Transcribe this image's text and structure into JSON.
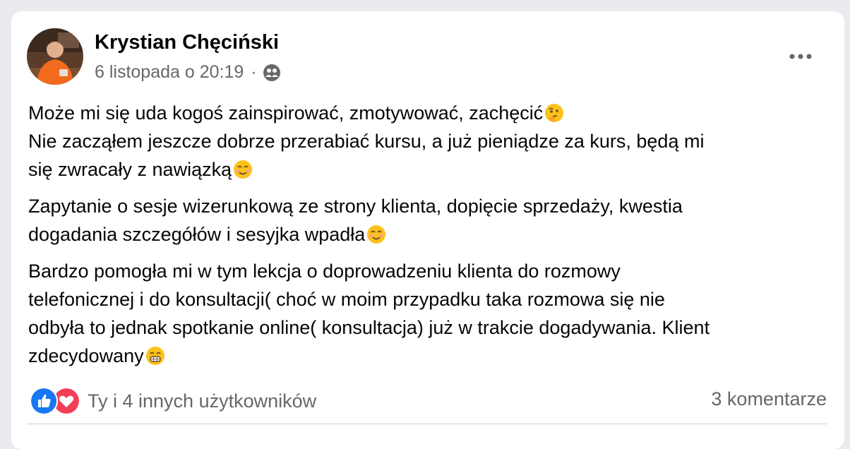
{
  "post": {
    "author": "Krystian Chęciński",
    "timestamp": "6 listopada o 20:19",
    "meta_separator": "·",
    "audience_icon": "people-icon",
    "menu_icon": "more-horizontal-icon",
    "paragraphs": [
      {
        "lines": [
          {
            "text": "Może mi się uda kogoś zainspirować, zmotywować, zachęcić",
            "emoji": "thinking-face-emoji"
          },
          {
            "text": "Nie zacząłem jeszcze dobrze przerabiać kursu, a już pieniądze za kurs, będą mi"
          },
          {
            "text": "się zwracały z nawiązką",
            "emoji": "smiling-face-emoji"
          }
        ]
      },
      {
        "lines": [
          {
            "text": "Zapytanie o sesje wizerunkową ze strony klienta, dopięcie sprzedaży, kwestia"
          },
          {
            "text": "dogadania szczegółów i sesyjka wpadła",
            "emoji": "smiling-face-emoji"
          }
        ]
      },
      {
        "lines": [
          {
            "text": "Bardzo pomogła mi w tym lekcja o doprowadzeniu klienta do rozmowy"
          },
          {
            "text": "telefonicznej i do konsultacji( choć w moim przypadku taka rozmowa się nie"
          },
          {
            "text": "odbyła to jednak spotkanie online( konsultacja) już w trakcie dogadywania. Klient"
          },
          {
            "text": "zdecydowany",
            "emoji": "grinning-face-emoji"
          }
        ]
      }
    ]
  },
  "reactions": {
    "icons": [
      "like-icon",
      "love-icon"
    ],
    "summary": "Ty i 4 innych użytkowników"
  },
  "comments": {
    "count_label": "3 komentarze"
  },
  "colors": {
    "like": "#1877f2",
    "love": "#f33e58",
    "secondary_text": "#65676b",
    "primary_text": "#050505"
  }
}
